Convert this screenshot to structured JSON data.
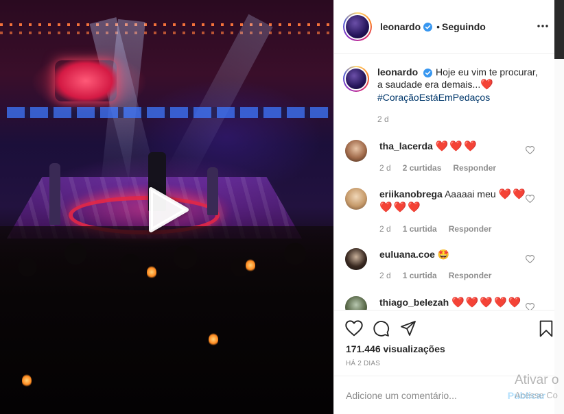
{
  "post": {
    "username": "leonardo",
    "follow_status": "Seguindo",
    "separator": "•",
    "caption_text": "Hoje eu vim te procurar, a saudade era demais...",
    "caption_emoji": "❤️",
    "hashtag": "#CoraçãoEstáEmPedaços",
    "caption_time": "2 d"
  },
  "comments": [
    {
      "username": "tha_lacerda",
      "text": "",
      "emoji": "❤️❤️❤️",
      "time": "2 d",
      "likes": "2 curtidas",
      "reply": "Responder"
    },
    {
      "username": "eriikanobrega",
      "text": "Aaaaai meu",
      "emoji": "❤️❤️",
      "emoji2": "❤️❤️❤️",
      "time": "2 d",
      "likes": "1 curtida",
      "reply": "Responder"
    },
    {
      "username": "euluana.coe",
      "text": "",
      "emoji": "🤩",
      "time": "2 d",
      "likes": "1 curtida",
      "reply": "Responder"
    },
    {
      "username": "thiago_belezah",
      "text": "",
      "emoji": "❤️❤️❤️❤️❤️",
      "time": "",
      "likes": "",
      "reply": ""
    }
  ],
  "stats": {
    "views": "171.446 visualizações",
    "posted": "HÁ 2 DIAS"
  },
  "composer": {
    "placeholder": "Adicione um comentário...",
    "publish_label": "Publicar"
  },
  "overlay": {
    "watermark_line1": "Ativar o",
    "watermark_line2": "Acesse Co"
  },
  "icons": {
    "verified": "verified-badge-icon",
    "more": "more-options-icon",
    "like": "heart-icon",
    "comment": "comment-icon",
    "share": "share-icon",
    "save": "bookmark-icon",
    "play": "play-icon"
  },
  "colors": {
    "verified_blue": "#3897f0",
    "hashtag": "#00376b",
    "muted_text": "#8e8e8e",
    "publish_disabled": "#b2dffc"
  }
}
